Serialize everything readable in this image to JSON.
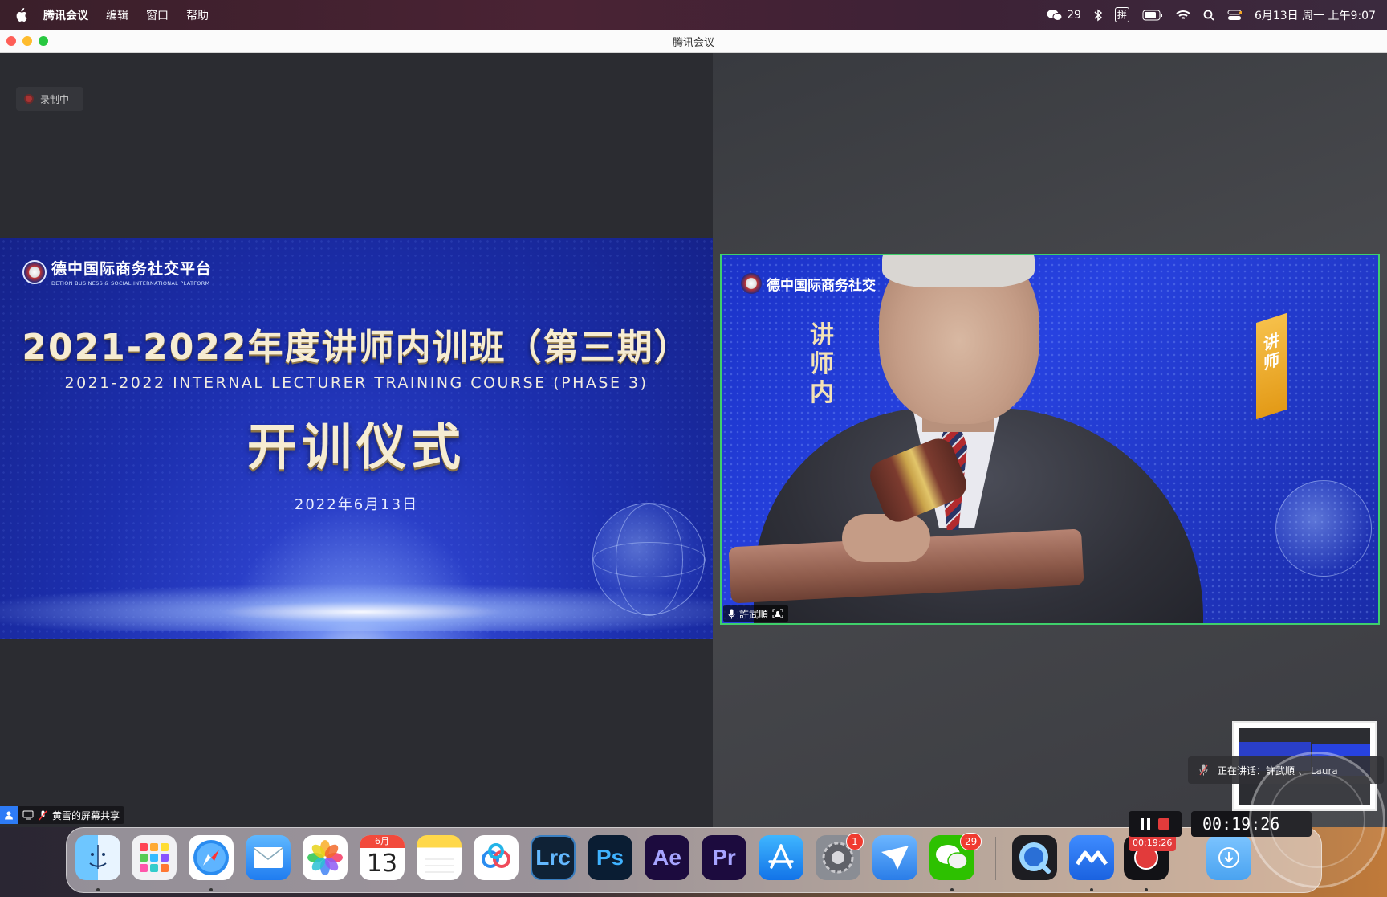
{
  "menubar": {
    "app_name": "腾讯会议",
    "menus": [
      "编辑",
      "窗口",
      "帮助"
    ],
    "wechat_count": "29",
    "input_method": "拼",
    "datetime": "6月13日 周一 上午9:07"
  },
  "window": {
    "title": "腾讯会议"
  },
  "recording_badge": "录制中",
  "slide": {
    "logo_cn": "德中国际商务社交平台",
    "logo_en": "DETION BUSINESS & SOCIAL INTERNATIONAL PLATFORM",
    "title_cn": "2021-2022年度讲师内训班（第三期）",
    "title_en": "2021-2022 INTERNAL LECTURER TRAINING COURSE (PHASE 3)",
    "ceremony": "开训仪式",
    "date": "2022年6月13日"
  },
  "video": {
    "logo_cn": "德中国际商务社交",
    "vertical_text": "讲师内",
    "banner_text": "讲师",
    "participant_name": "許武順"
  },
  "share_tag": {
    "label": "黄雪的屏幕共享"
  },
  "speaking": {
    "label": "正在讲话：許武順",
    "suffix": "、 Laura"
  },
  "recording": {
    "timer": "00:19:26",
    "dock_timer": "00:19:26"
  },
  "dock": {
    "calendar_month": "6月",
    "calendar_day": "13",
    "settings_badge": "1",
    "wechat_badge": "29",
    "apps": {
      "lrc": "Lrc",
      "ps": "Ps",
      "ae": "Ae",
      "pr": "Pr"
    }
  },
  "colors": {
    "active_speaker_border": "#3fd06b",
    "record_red": "#e23b3b",
    "share_blue": "#2d7bf6"
  }
}
